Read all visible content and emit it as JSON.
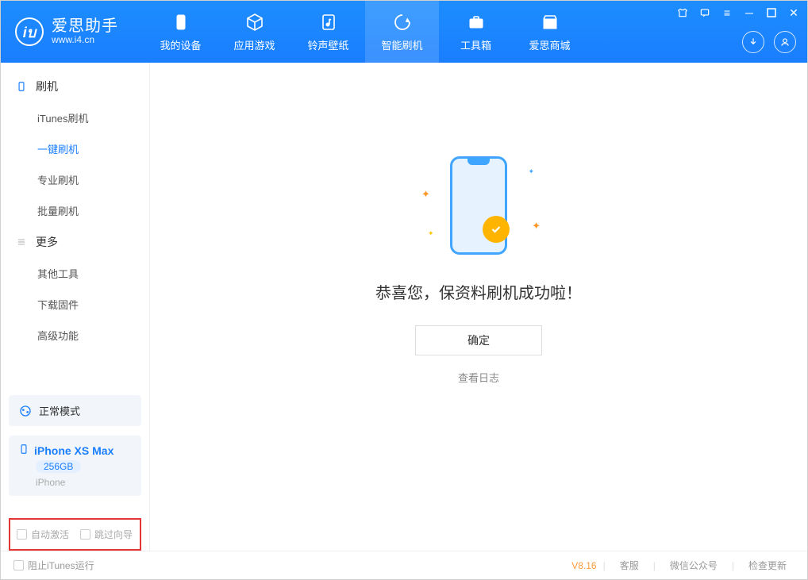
{
  "app": {
    "title": "爱思助手",
    "subtitle": "www.i4.cn",
    "logo_letter": "iบ"
  },
  "tabs": {
    "device": "我的设备",
    "apps": "应用游戏",
    "ringtone": "铃声壁纸",
    "flash": "智能刷机",
    "toolbox": "工具箱",
    "store": "爱思商城"
  },
  "sidebar": {
    "section1": "刷机",
    "items1": [
      "iTunes刷机",
      "一键刷机",
      "专业刷机",
      "批量刷机"
    ],
    "section2": "更多",
    "items2": [
      "其他工具",
      "下载固件",
      "高级功能"
    ]
  },
  "device": {
    "mode": "正常模式",
    "name": "iPhone XS Max",
    "capacity": "256GB",
    "type": "iPhone"
  },
  "options": {
    "auto_activate": "自动激活",
    "skip_guide": "跳过向导"
  },
  "main": {
    "success": "恭喜您，保资料刷机成功啦！",
    "ok": "确定",
    "view_log": "查看日志"
  },
  "footer": {
    "block_itunes": "阻止iTunes运行",
    "version": "V8.16",
    "support": "客服",
    "wechat": "微信公众号",
    "update": "检查更新"
  }
}
